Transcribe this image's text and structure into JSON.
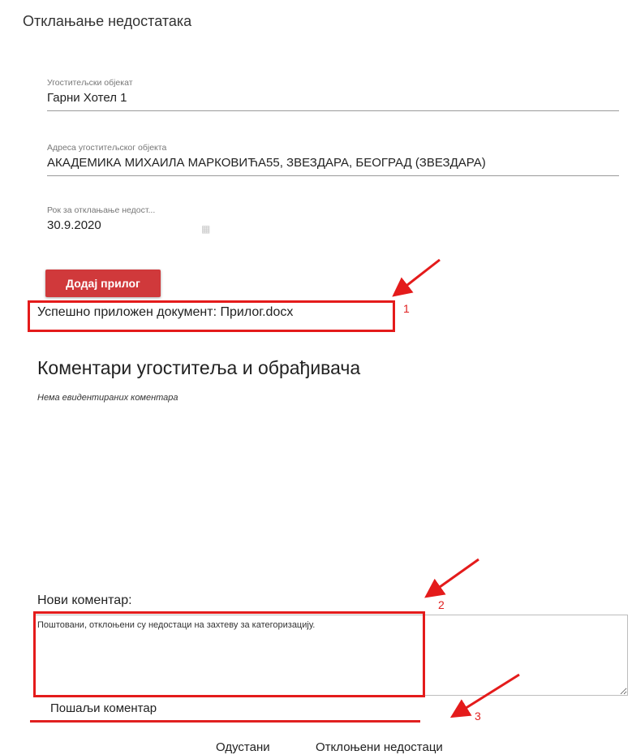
{
  "page_title": "Отклањање недостатака",
  "fields": {
    "facility": {
      "label": "Угоститељски објекат",
      "value": "Гарни Хотел 1"
    },
    "address": {
      "label": "Адреса угоститељског објекта",
      "value": "АКАДЕМИКА МИХАИЛА МАРКОВИЋА55, ЗВЕЗДАРА, БЕОГРАД (ЗВЕЗДАРА)"
    },
    "deadline": {
      "label": "Рок за отклањање недост...",
      "value": "30.9.2020"
    }
  },
  "attach_button": "Додај прилог",
  "attach_success": "Успешно приложен документ: Прилог.docx",
  "comments_section": {
    "title": "Коментари угоститеља и обрађивача",
    "empty_text": "Нема евидентираних коментара"
  },
  "new_comment": {
    "label": "Нови коментар:",
    "text": "Поштовани, отклоњени су недостаци на захтеву за категоризацију."
  },
  "send_comment": "Пошаљи коментар",
  "footer": {
    "cancel": "Одустани",
    "resolved": "Отклоњени недостаци"
  },
  "annotations": [
    "1",
    "2",
    "3"
  ],
  "colors": {
    "accent_button": "#d0393b",
    "annotation_red": "#e41b1b"
  }
}
